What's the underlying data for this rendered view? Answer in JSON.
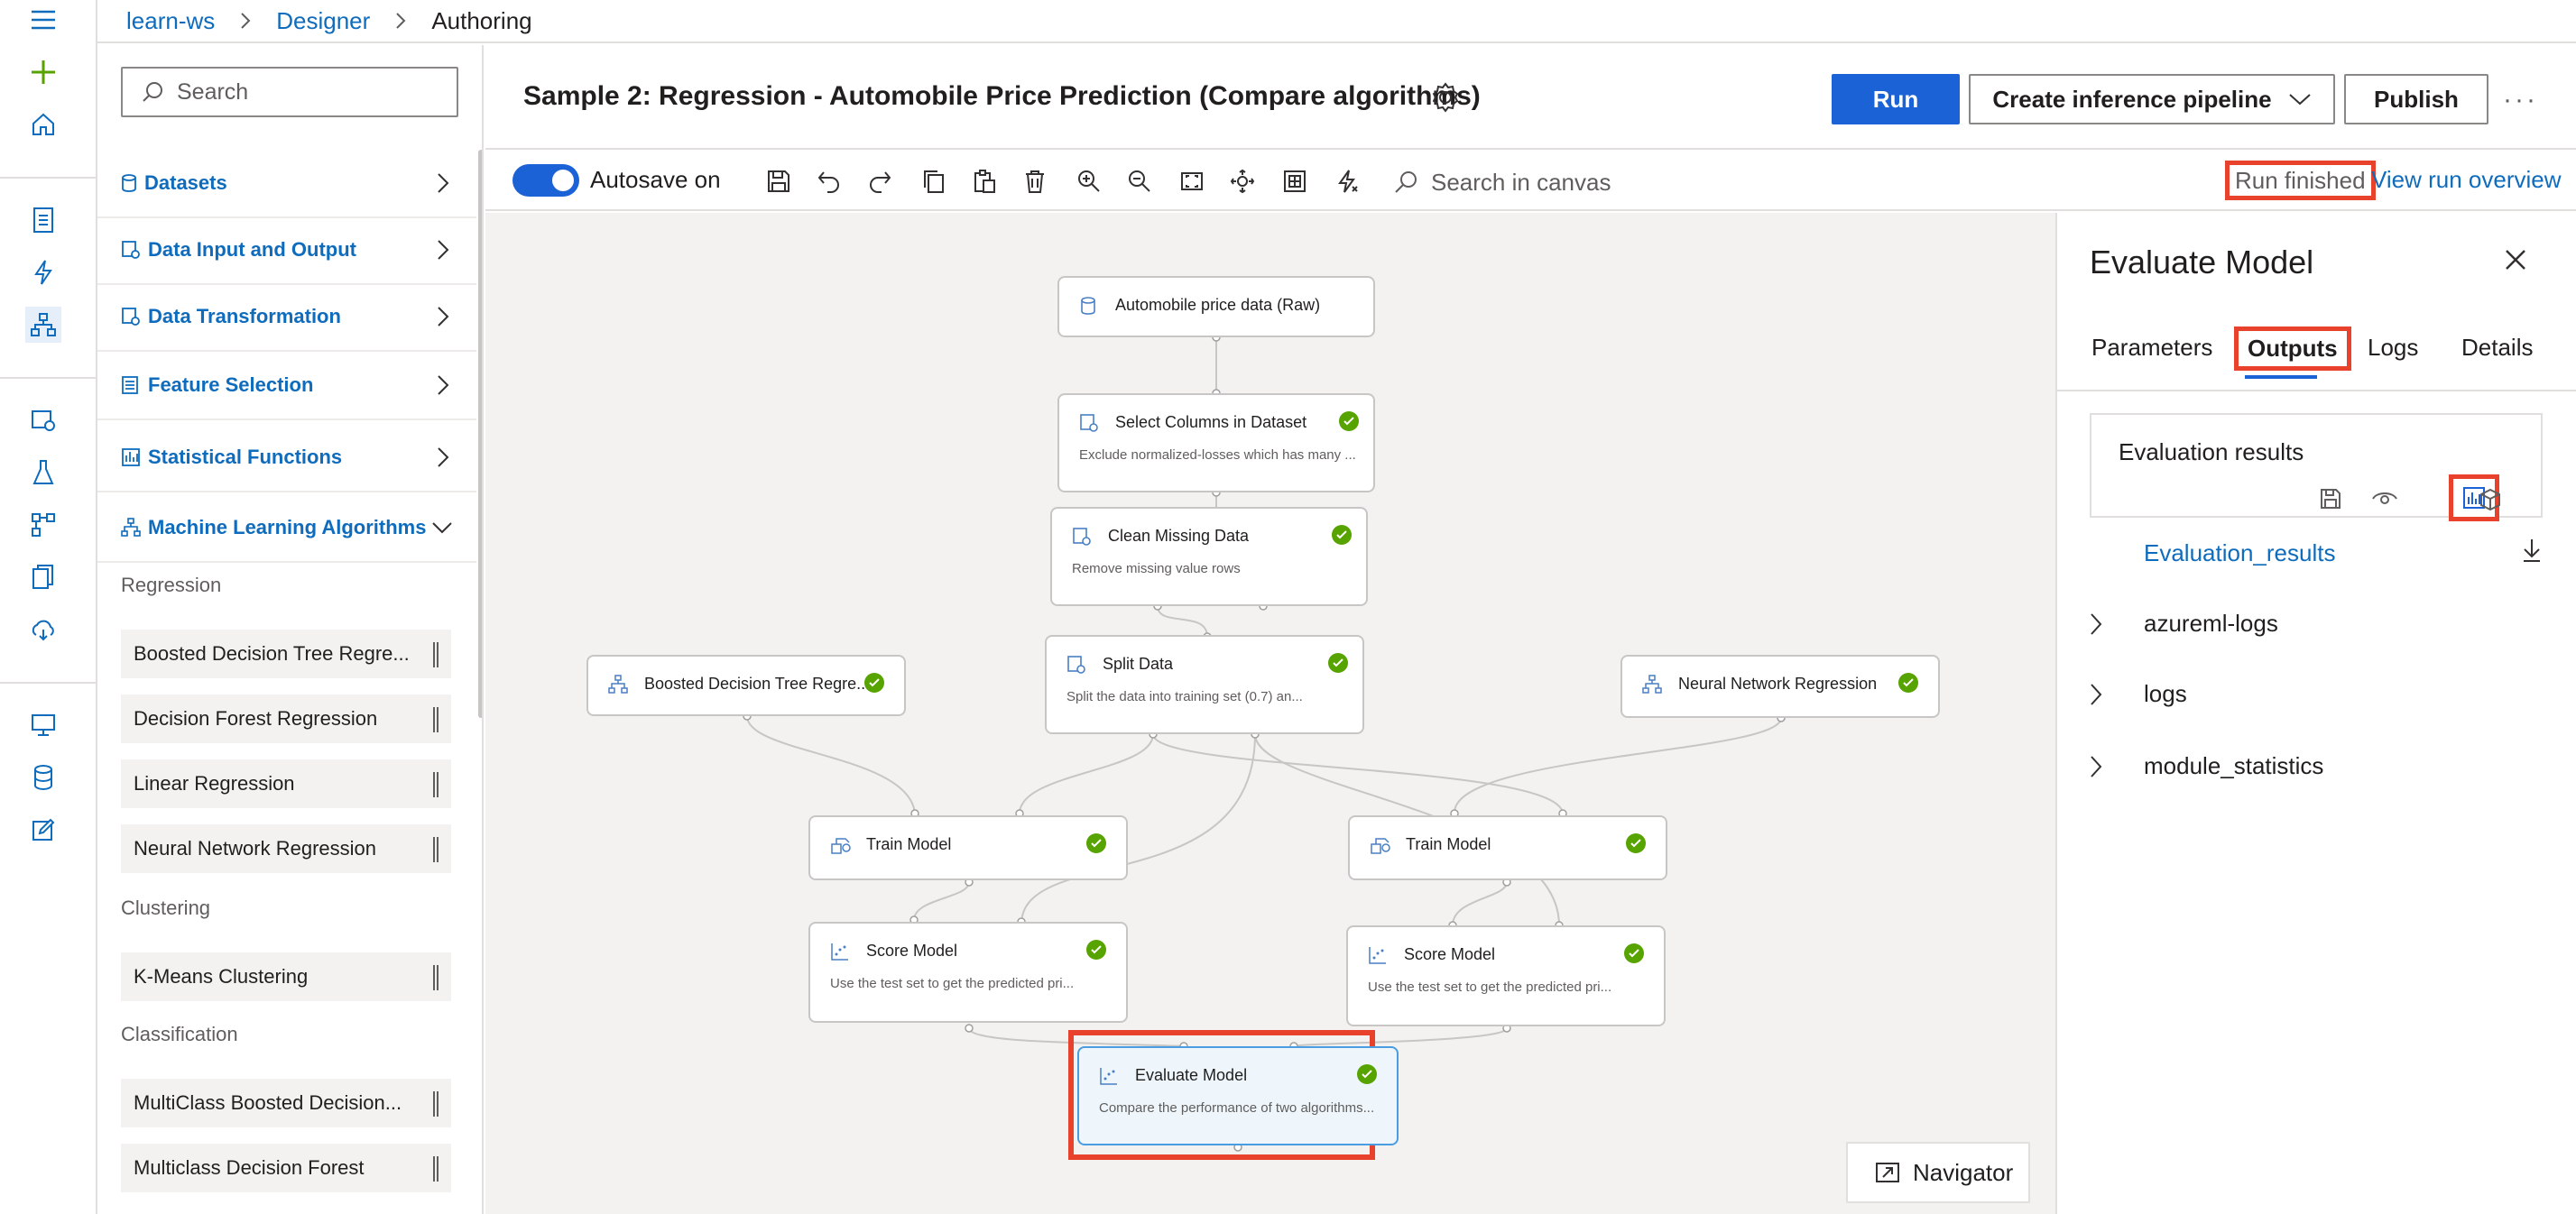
{
  "breadcrumb": {
    "workspace": "learn-ws",
    "section": "Designer",
    "current": "Authoring"
  },
  "palette": {
    "search_placeholder": "Search",
    "categories": [
      {
        "label": "Datasets"
      },
      {
        "label": "Data Input and Output"
      },
      {
        "label": "Data Transformation"
      },
      {
        "label": "Feature Selection"
      },
      {
        "label": "Statistical Functions"
      },
      {
        "label": "Machine Learning Algorithms"
      }
    ],
    "groups": {
      "regression": {
        "label": "Regression",
        "items": [
          "Boosted Decision Tree Regre...",
          "Decision Forest Regression",
          "Linear Regression",
          "Neural Network Regression"
        ]
      },
      "clustering": {
        "label": "Clustering",
        "items": [
          "K-Means Clustering"
        ]
      },
      "classification": {
        "label": "Classification",
        "items": [
          "MultiClass Boosted Decision...",
          "Multiclass Decision Forest"
        ]
      }
    }
  },
  "header": {
    "title": "Sample 2: Regression - Automobile Price Prediction (Compare algorithms)",
    "run_label": "Run",
    "inference_label": "Create inference pipeline",
    "publish_label": "Publish",
    "more_label": "···"
  },
  "toolbar": {
    "autosave_label": "Autosave on",
    "autosave_on": true,
    "search_placeholder": "Search in canvas",
    "run_status": "Run finished",
    "run_overview_link": "View run overview"
  },
  "canvas": {
    "nodes": {
      "raw_data": {
        "title": "Automobile price data (Raw)"
      },
      "select_columns": {
        "title": "Select Columns in Dataset",
        "desc": "Exclude normalized-losses which has many ...",
        "status": "completed"
      },
      "clean_missing": {
        "title": "Clean Missing Data",
        "desc": "Remove missing value rows",
        "status": "completed"
      },
      "split_data": {
        "title": "Split Data",
        "desc": "Split the data into training set (0.7) an...",
        "status": "completed"
      },
      "boosted_tree": {
        "title": "Boosted Decision Tree Regre...",
        "status": "completed"
      },
      "neural_net": {
        "title": "Neural Network Regression",
        "status": "completed"
      },
      "train_left": {
        "title": "Train Model",
        "status": "completed"
      },
      "train_right": {
        "title": "Train Model",
        "status": "completed"
      },
      "score_left": {
        "title": "Score Model",
        "desc": "Use the test set to get the predicted pri...",
        "status": "completed"
      },
      "score_right": {
        "title": "Score Model",
        "desc": "Use the test set to get the predicted pri...",
        "status": "completed"
      },
      "evaluate": {
        "title": "Evaluate Model",
        "desc": "Compare the performance of two algorithms...",
        "status": "completed"
      }
    },
    "navigator_label": "Navigator"
  },
  "right_panel": {
    "title": "Evaluate Model",
    "tabs": [
      "Parameters",
      "Outputs",
      "Logs",
      "Details"
    ],
    "active_tab": "Outputs",
    "card_title": "Evaluation results",
    "card_icons": [
      "save-icon",
      "eye-icon",
      "chart-icon",
      "cube-icon"
    ],
    "result_link": "Evaluation_results",
    "folders": [
      "azureml-logs",
      "logs",
      "module_statistics"
    ]
  },
  "colors": {
    "accent": "#1a62d6",
    "success": "#57a300",
    "highlight": "#e8412c",
    "link": "#0f6cbd"
  }
}
